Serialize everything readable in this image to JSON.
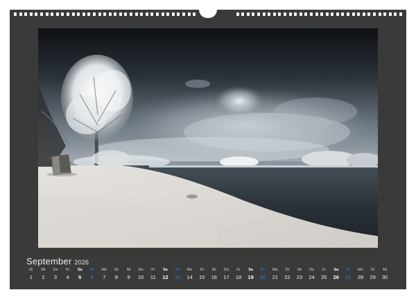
{
  "calendar": {
    "month": "September",
    "year": "2026",
    "days": [
      {
        "wd": "Di",
        "d": "1",
        "type": "weekday"
      },
      {
        "wd": "Mi",
        "d": "2",
        "type": "weekday"
      },
      {
        "wd": "Do",
        "d": "3",
        "type": "weekday"
      },
      {
        "wd": "Fr",
        "d": "4",
        "type": "weekday"
      },
      {
        "wd": "Sa",
        "d": "5",
        "type": "sat"
      },
      {
        "wd": "So",
        "d": "6",
        "type": "sun"
      },
      {
        "wd": "Mo",
        "d": "7",
        "type": "weekday"
      },
      {
        "wd": "Di",
        "d": "8",
        "type": "weekday"
      },
      {
        "wd": "Mi",
        "d": "9",
        "type": "weekday"
      },
      {
        "wd": "Do",
        "d": "10",
        "type": "weekday"
      },
      {
        "wd": "Fr",
        "d": "11",
        "type": "weekday"
      },
      {
        "wd": "Sa",
        "d": "12",
        "type": "sat"
      },
      {
        "wd": "So",
        "d": "13",
        "type": "sun"
      },
      {
        "wd": "Mo",
        "d": "14",
        "type": "weekday"
      },
      {
        "wd": "Di",
        "d": "15",
        "type": "weekday"
      },
      {
        "wd": "Mi",
        "d": "16",
        "type": "weekday"
      },
      {
        "wd": "Do",
        "d": "17",
        "type": "weekday"
      },
      {
        "wd": "Fr",
        "d": "18",
        "type": "weekday"
      },
      {
        "wd": "Sa",
        "d": "19",
        "type": "sat"
      },
      {
        "wd": "So",
        "d": "20",
        "type": "sun"
      },
      {
        "wd": "Mo",
        "d": "21",
        "type": "weekday"
      },
      {
        "wd": "Di",
        "d": "22",
        "type": "weekday"
      },
      {
        "wd": "Mi",
        "d": "23",
        "type": "weekday"
      },
      {
        "wd": "Do",
        "d": "24",
        "type": "weekday"
      },
      {
        "wd": "Fr",
        "d": "25",
        "type": "weekday"
      },
      {
        "wd": "Sa",
        "d": "26",
        "type": "sat"
      },
      {
        "wd": "So",
        "d": "27",
        "type": "sun"
      },
      {
        "wd": "Mo",
        "d": "28",
        "type": "weekday"
      },
      {
        "wd": "Di",
        "d": "29",
        "type": "weekday"
      },
      {
        "wd": "Mi",
        "d": "30",
        "type": "weekday"
      }
    ]
  },
  "colors": {
    "page": "#3a3a3a",
    "sunday": "#2f6fb0",
    "text": "#f2f2f2"
  },
  "photo": {
    "subject": "infrared landscape: frosted tree, lake, dramatic sky"
  }
}
